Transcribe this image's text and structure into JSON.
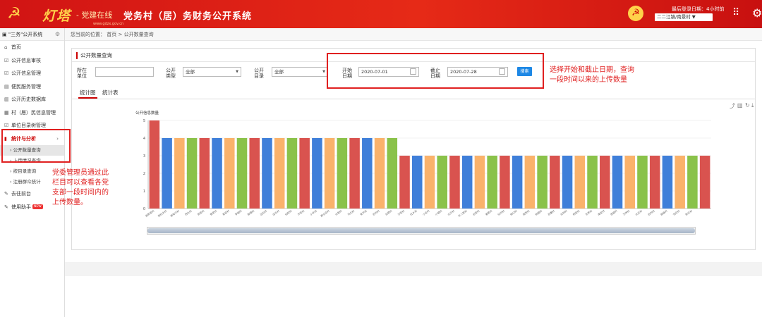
{
  "header": {
    "brand_name": "灯塔",
    "brand_suffix": "- 党建在线",
    "brand_sub": "www.gdzx.gov.cn",
    "system_title": "党务村（居）务财务公开系统",
    "login_text": "最后登录日期：4小时前",
    "user_label": "二二江镇/南景村 ▼"
  },
  "sidebar": {
    "system_name": "\"三务\"公开系统",
    "items": [
      {
        "label": "首页",
        "icon": "⌂"
      },
      {
        "label": "公开信息审核",
        "icon": "☑"
      },
      {
        "label": "公开信息管理",
        "icon": "☑"
      },
      {
        "label": "便民服务管理",
        "icon": "▤"
      },
      {
        "label": "公开历史数据库",
        "icon": "▥"
      },
      {
        "label": "村（居）民信息管理",
        "icon": "▦"
      },
      {
        "label": "单位目录树管理",
        "icon": "☑"
      }
    ],
    "active": {
      "label": "统计与分析",
      "icon": "▮"
    },
    "subitems": [
      "公开数量查询",
      "上传情况查询",
      "按目录查询",
      "注册群众统计"
    ],
    "bottom": [
      {
        "label": "去往前台",
        "icon": "✎"
      },
      {
        "label": "使用助手",
        "icon": "✎",
        "badge": "NEW"
      }
    ]
  },
  "breadcrumb": {
    "prefix": "您当前的位置：",
    "home": "首页",
    "sep": ">",
    "current": "公开数量查询"
  },
  "panel": {
    "title": "公开数量查询",
    "filters": {
      "unit_label": "所在单位",
      "unit_value": "",
      "type_label": "公开类型",
      "type_value": "全部",
      "dir_label": "公开目录",
      "dir_value": "全部",
      "start_label": "开始日期",
      "start_value": "2020-07-01",
      "end_label": "截止日期",
      "end_value": "2020-07-28",
      "search_label": "搜索"
    },
    "tabs": [
      "统计图",
      "统计表"
    ]
  },
  "annotations": {
    "date_note_1": "选择开始和截止日期，查询",
    "date_note_2": "一段时间以来的上传数量",
    "side_note_lines": [
      "党委管理员通过此",
      "栏目可以查看各党",
      "支部一段时间内的",
      "上传数量。"
    ]
  },
  "chart_data": {
    "type": "bar",
    "title": "公开信息数量",
    "ylim": [
      0,
      5
    ],
    "yticks": [
      "0",
      "1",
      "2",
      "3",
      "4",
      "5"
    ],
    "categories": [
      "南贾家村",
      "西杜乡村",
      "南甸子村",
      "西头村",
      "新家村",
      "焦家村",
      "官窑村",
      "李固村",
      "聊喂村",
      "边石村",
      "店头村",
      "仙旺村",
      "齐家村",
      "小辛村",
      "西仝庄村",
      "大盘村",
      "河北村",
      "安平村",
      "后沟村",
      "北堤村",
      "沙家村",
      "红乡村",
      "小庄村",
      "小留村",
      "北于村",
      "东八里村",
      "谷家村",
      "港里村",
      "仙沟村",
      "柳口村",
      "南贾村",
      "桃园村",
      "后曹村",
      "北刘村",
      "杨官村",
      "东李村",
      "南史村",
      "杏园村",
      "万甲村",
      "北庄村",
      "后刘村",
      "胡庙村",
      "刘庄村",
      "新庄村"
    ],
    "values": [
      5,
      4,
      4,
      4,
      4,
      4,
      4,
      4,
      4,
      4,
      4,
      4,
      4,
      4,
      4,
      4,
      4,
      4,
      4,
      4,
      3,
      3,
      3,
      3,
      3,
      3,
      3,
      3,
      3,
      3,
      3,
      3,
      3,
      3,
      3,
      3,
      3,
      3,
      3,
      3,
      3,
      3,
      3,
      3,
      3
    ],
    "bar_colors": [
      "#d9534f",
      "#3f7fd9",
      "#fab26b",
      "#8ac24a"
    ],
    "grid": true,
    "legend": "none"
  }
}
